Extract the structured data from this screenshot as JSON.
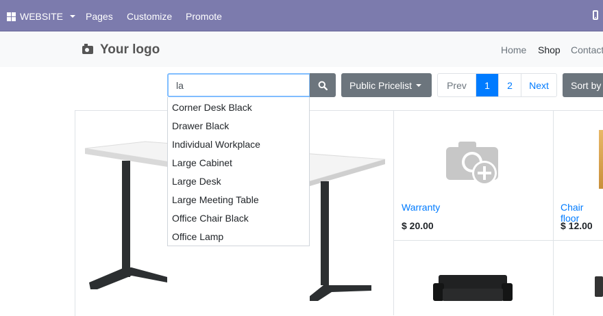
{
  "topbar": {
    "website_label": "WEBSITE",
    "links": [
      "Pages",
      "Customize",
      "Promote"
    ],
    "mobile_icon": "mobile-preview-icon"
  },
  "header": {
    "logo_text": "Your logo",
    "nav": [
      "Home",
      "Shop",
      "Contact"
    ]
  },
  "search": {
    "value": "la",
    "suggestions": [
      "Corner Desk Black",
      "Drawer Black",
      "Individual Workplace",
      "Large Cabinet",
      "Large Desk",
      "Large Meeting Table",
      "Office Chair Black",
      "Office Lamp"
    ]
  },
  "controls": {
    "pricelist_label": "Public Pricelist",
    "pager": {
      "prev": "Prev",
      "pages": [
        "1",
        "2"
      ],
      "next": "Next",
      "current": "1"
    },
    "sort_label": "Sort by"
  },
  "products": [
    {
      "name": "Warranty",
      "price": "$ 20.00"
    },
    {
      "name": "Chair floor",
      "price": "$ 12.00"
    }
  ],
  "colors": {
    "topbar_bg": "#7c7bad",
    "accent": "#007bff",
    "button_gray": "#6c757d"
  }
}
